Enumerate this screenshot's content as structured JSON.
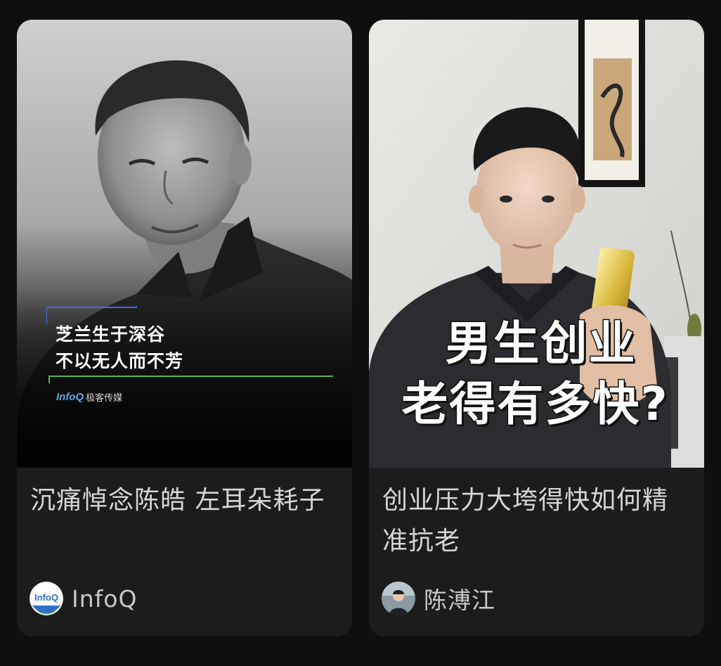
{
  "feed": {
    "cards": [
      {
        "cover": {
          "quote_line_1": "芝兰生于深谷",
          "quote_line_2": "不以无人而不芳",
          "brand_logo": "InfoQ",
          "brand_media": "极客传媒",
          "image": "grayscale-portrait-man-dark-shirt"
        },
        "title": "沉痛悼念陈皓 左耳朵耗子",
        "author": {
          "name": "InfoQ",
          "avatar_text": "InfoQ",
          "avatar_icon": "infoq-logo-avatar"
        }
      },
      {
        "cover": {
          "caption_line_1": "男生创业",
          "caption_line_2": "老得有多快?",
          "image": "man-holding-gold-bar-living-room"
        },
        "title": "创业压力大垮得快如何精准抗老",
        "author": {
          "name": "陈溥江",
          "avatar_icon": "person-photo-avatar"
        }
      }
    ]
  },
  "colors": {
    "page_background": "#0f0f0f",
    "card_background": "#1c1c1c",
    "title_text": "#d6d6d6",
    "author_text": "#c9c9c9",
    "infoq_blue": "#2f6fc9",
    "infoq_green": "#3fae49"
  }
}
